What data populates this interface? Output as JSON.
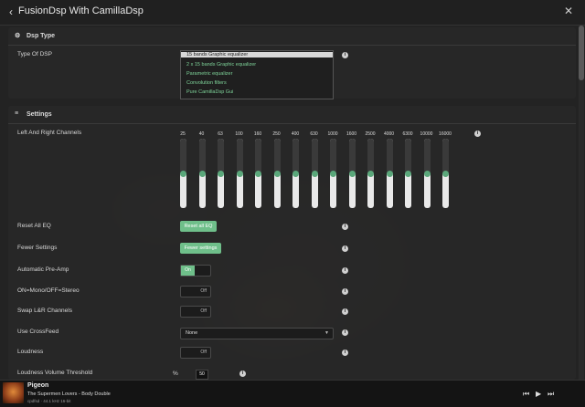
{
  "header": {
    "title": "FusionDsp With CamillaDsp",
    "back_icon": "chevron-left-icon",
    "close_icon": "close-icon"
  },
  "dsp_type": {
    "section_title": "Dsp Type",
    "field_label": "Type Of DSP",
    "options": [
      "15 bands Graphic equalizer",
      "2 x 15 bands Graphic equalizer",
      "Parametric equalizer",
      "Convolution filters",
      "Pure CamillaDsp Gui"
    ],
    "selected_index": 0
  },
  "settings": {
    "section_title": "Settings",
    "channels_label": "Left And Right Channels",
    "bands": [
      "25",
      "40",
      "63",
      "100",
      "160",
      "250",
      "400",
      "630",
      "1000",
      "1600",
      "2500",
      "4000",
      "6300",
      "10000",
      "16000"
    ],
    "band_levels": [
      0.5,
      0.5,
      0.5,
      0.5,
      0.5,
      0.5,
      0.5,
      0.5,
      0.5,
      0.5,
      0.5,
      0.5,
      0.5,
      0.5,
      0.5
    ],
    "reset_label": "Reset All EQ",
    "reset_button": "Reset all EQ",
    "fewer_label": "Fewer Settings",
    "fewer_button": "Fewer settings",
    "preamp_label": "Automatic Pre-Amp",
    "preamp_state": "On",
    "mono_label": "ON=Mono/OFF=Stereo",
    "mono_state": "Off",
    "swap_label": "Swap L&R Channels",
    "swap_state": "Off",
    "crossfeed_label": "Use CrossFeed",
    "crossfeed_value": "None",
    "loudness_label": "Loudness",
    "loudness_state": "Off",
    "threshold_label": "Loudness Volume Threshold",
    "threshold_unit": "%",
    "threshold_value": "50"
  },
  "player": {
    "title": "Pigeon",
    "subtitle": "The Supermen Lovers - Body Double",
    "meta": "cpdfsd  ·  44.1 kHz 16-bit",
    "controls": [
      "prev-icon",
      "play-icon",
      "next-icon"
    ]
  },
  "colors": {
    "accent": "#6fbf8a",
    "background": "#232323"
  }
}
